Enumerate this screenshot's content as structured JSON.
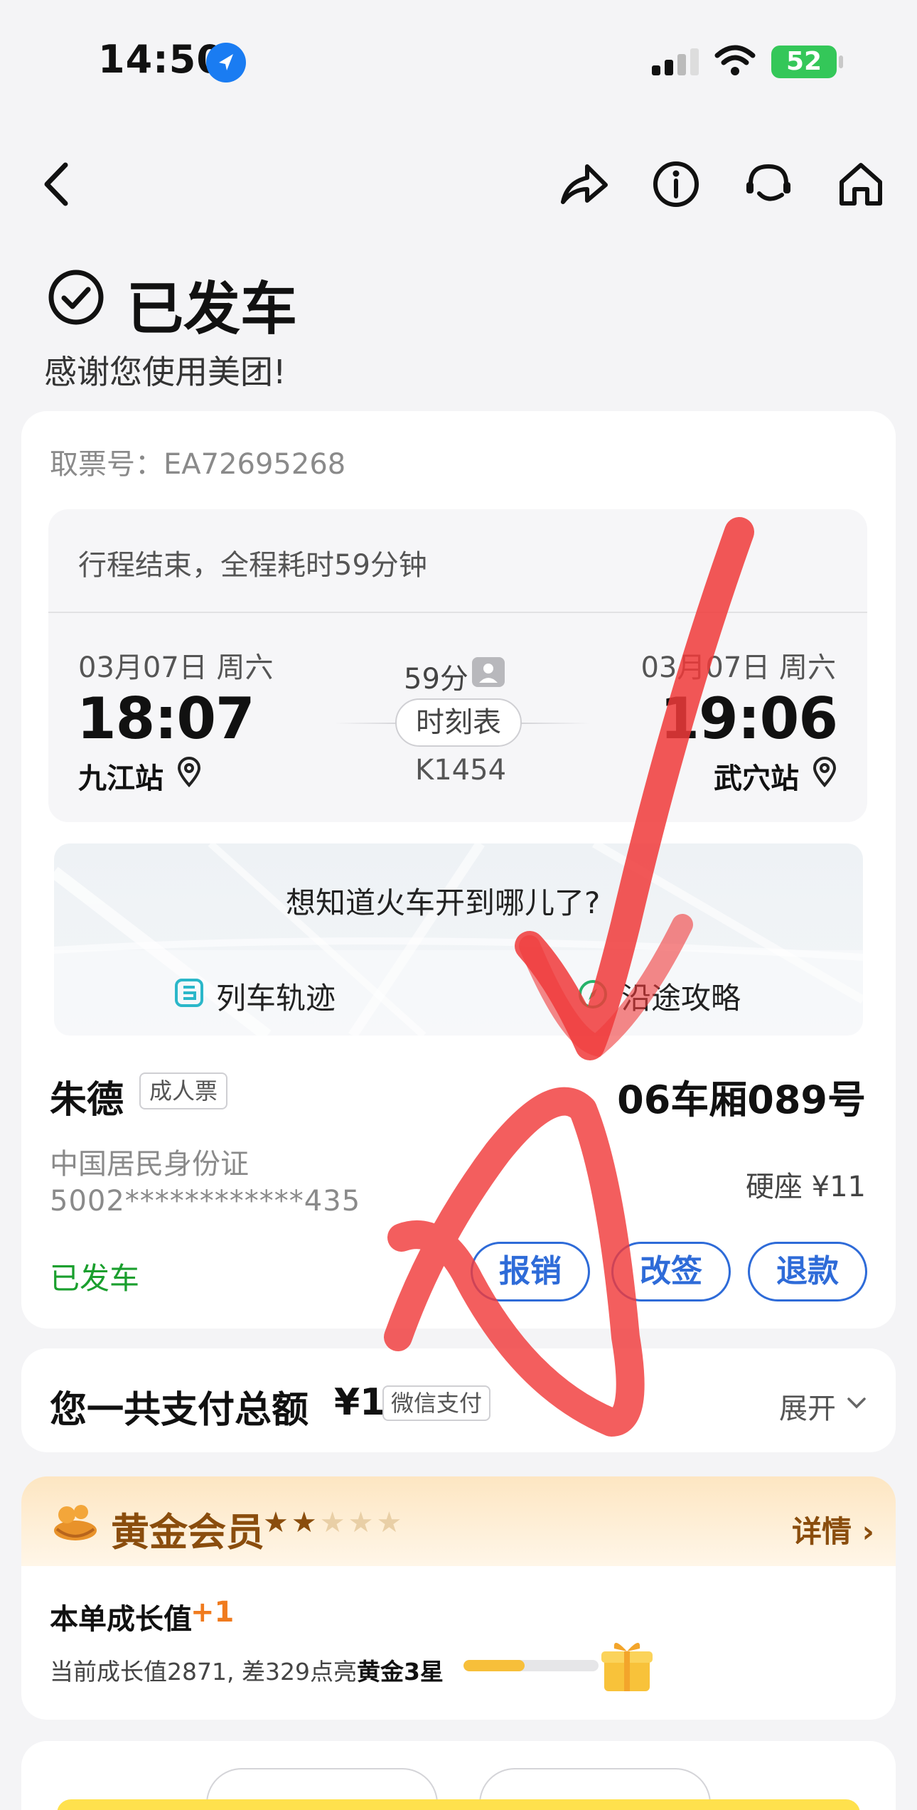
{
  "status_bar": {
    "time": "14:50",
    "battery": "52"
  },
  "header": {
    "title": "已发车",
    "subtitle": "感谢您使用美团!"
  },
  "ticket": {
    "ticket_no": "取票号：EA72695268",
    "trip_status": "行程结束，全程耗时59分钟",
    "departure": {
      "date": "03月07日 周六",
      "time": "18:07",
      "station": "九江站"
    },
    "arrival": {
      "date": "03月07日 周六",
      "time": "19:06",
      "station": "武穴站"
    },
    "duration": "59分",
    "timetable_label": "时刻表",
    "train_no": "K1454"
  },
  "map": {
    "question": "想知道火车开到哪儿了?",
    "track_label": "列车轨迹",
    "guide_label": "沿途攻略"
  },
  "passenger": {
    "name": "朱德",
    "ticket_type": "成人票",
    "seat": "06车厢089号",
    "id_type": "中国居民身份证",
    "id_number": "5002************435",
    "seat_price": "硬座 ¥11",
    "status": "已发车",
    "actions": {
      "reimburse": "报销",
      "change": "改签",
      "refund": "退款"
    }
  },
  "payment": {
    "label": "您一共支付总额",
    "amount": "¥1",
    "method": "微信支付",
    "expand": "展开"
  },
  "membership": {
    "title": "黄金会员",
    "stars_filled": 2,
    "stars_total": 5,
    "details": "详情",
    "growth_label": "本单成长值",
    "growth_plus": "+1",
    "growth_current": "当前成长值2871, 差329点亮",
    "growth_target": "黄金3星",
    "progress": 0.45
  },
  "colors": {
    "accent_blue": "#2e6bd8",
    "status_green": "#1a9f2e",
    "gold_brown": "#8a4d0d",
    "annotation_red": "#f03a3a"
  }
}
